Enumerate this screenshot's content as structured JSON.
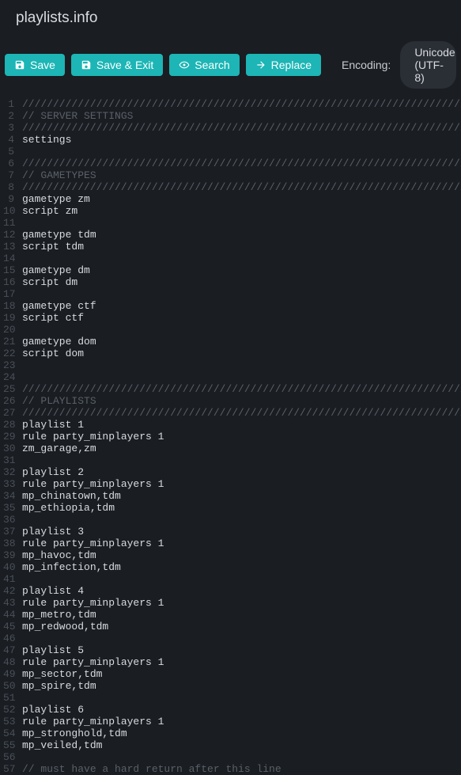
{
  "title": "playlists.info",
  "toolbar": {
    "save_label": "Save",
    "save_exit_label": "Save & Exit",
    "search_label": "Search",
    "replace_label": "Replace",
    "encoding_label": "Encoding:",
    "encoding_value": "Unicode (UTF-8)"
  },
  "code_lines": [
    "///////////////////////////////////////////////////////////////////////////",
    "// SERVER SETTINGS",
    "///////////////////////////////////////////////////////////////////////////",
    "settings",
    "",
    "///////////////////////////////////////////////////////////////////////////",
    "// GAMETYPES",
    "///////////////////////////////////////////////////////////////////////////",
    "gametype zm",
    "script zm",
    "",
    "gametype tdm",
    "script tdm",
    "",
    "gametype dm",
    "script dm",
    "",
    "gametype ctf",
    "script ctf",
    "",
    "gametype dom",
    "script dom",
    "",
    "",
    "///////////////////////////////////////////////////////////////////////////",
    "// PLAYLISTS",
    "///////////////////////////////////////////////////////////////////////////",
    "playlist 1",
    "rule party_minplayers 1",
    "zm_garage,zm",
    "",
    "playlist 2",
    "rule party_minplayers 1",
    "mp_chinatown,tdm",
    "mp_ethiopia,tdm",
    "",
    "playlist 3",
    "rule party_minplayers 1",
    "mp_havoc,tdm",
    "mp_infection,tdm",
    "",
    "playlist 4",
    "rule party_minplayers 1",
    "mp_metro,tdm",
    "mp_redwood,tdm",
    "",
    "playlist 5",
    "rule party_minplayers 1",
    "mp_sector,tdm",
    "mp_spire,tdm",
    "",
    "playlist 6",
    "rule party_minplayers 1",
    "mp_stronghold,tdm",
    "mp_veiled,tdm",
    "",
    "// must have a hard return after this line"
  ]
}
